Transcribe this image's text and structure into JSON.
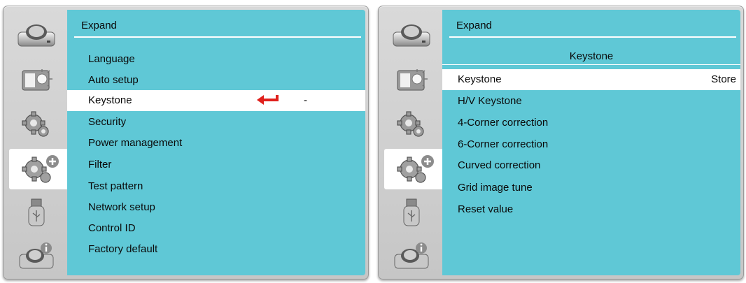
{
  "left_menu": {
    "title": "Expand",
    "items": [
      {
        "label": "Language"
      },
      {
        "label": "Auto setup"
      },
      {
        "label": "Keystone",
        "value": "-"
      },
      {
        "label": "Security"
      },
      {
        "label": "Power management"
      },
      {
        "label": "Filter"
      },
      {
        "label": "Test pattern"
      },
      {
        "label": "Network setup"
      },
      {
        "label": "Control ID"
      },
      {
        "label": "Factory default"
      }
    ],
    "selected_index": 2
  },
  "right_menu": {
    "title": "Expand",
    "subtitle": "Keystone",
    "items": [
      {
        "label": "Keystone",
        "value": "Store"
      },
      {
        "label": "H/V Keystone"
      },
      {
        "label": "4-Corner correction"
      },
      {
        "label": "6-Corner correction"
      },
      {
        "label": "Curved correction"
      },
      {
        "label": "Grid image tune"
      },
      {
        "label": "Reset value"
      }
    ],
    "selected_index": 0
  },
  "sidebar": {
    "icons": [
      "camera-icon",
      "display-brightness-icon",
      "gear-icon",
      "gear-plus-icon",
      "usb-icon",
      "camera-info-icon"
    ],
    "selected_icon": "gear-plus-icon"
  },
  "colors": {
    "menu_bg": "#5fc8d6",
    "panel_bg": "#d2d2d2",
    "selection": "#ffffff",
    "enter_arrow": "#e0201c"
  }
}
